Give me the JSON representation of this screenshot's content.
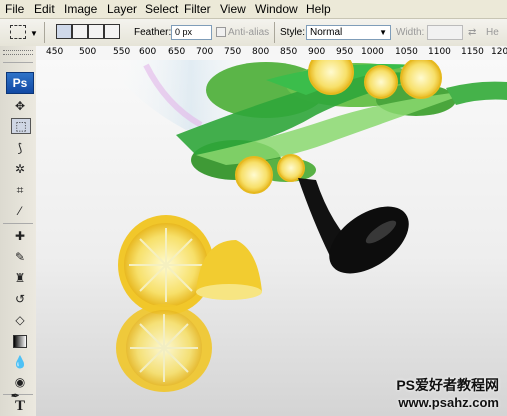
{
  "menu": [
    "File",
    "Edit",
    "Image",
    "Layer",
    "Select",
    "Filter",
    "View",
    "Window",
    "Help"
  ],
  "options": {
    "feather_label": "Feather:",
    "feather_value": "0 px",
    "antialias_label": "Anti-alias",
    "style_label": "Style:",
    "style_value": "Normal",
    "width_label": "Width:",
    "height_label": "He"
  },
  "tools_logo": "Ps",
  "tools": [
    "move-tool",
    "marquee-tool",
    "lasso-tool",
    "magic-wand-tool",
    "crop-tool",
    "eyedropper-tool",
    "healing-brush-tool",
    "brush-tool",
    "clone-stamp-tool",
    "history-brush-tool",
    "eraser-tool",
    "gradient-tool",
    "blur-tool",
    "dodge-tool",
    "pen-tool",
    "type-tool"
  ],
  "ruler_ticks": [
    "450",
    "500",
    "550",
    "600",
    "650",
    "700",
    "750",
    "800",
    "850",
    "900",
    "950",
    "1000",
    "1050",
    "1100",
    "1150",
    "120"
  ],
  "watermark": {
    "line1": "PS爱好者教程网",
    "line2": "www.psahz.com"
  },
  "colors": {
    "menubar": "#ece9d8",
    "ps_logo": "#1f5fbf",
    "lemon": "#f4d23a",
    "leaf": "#3aa33a"
  }
}
